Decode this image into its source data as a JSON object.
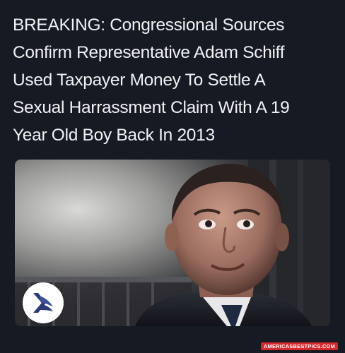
{
  "post": {
    "headline_lines": [
      "BREAKING: Congressional Sources",
      "Confirm Representative Adam Schiff",
      "Used Taxpayer Money To Settle A",
      "Sexual Harrassment Claim With A 19",
      "Year Old Boy Back In 2013"
    ]
  },
  "watermark": {
    "text": "AMERICASBESTPICS.COM"
  },
  "colors": {
    "background": "#161a23",
    "headline_text": "#f1f1f3",
    "watermark_bg": "#d4282c",
    "logo_mark": "#2b3a78"
  },
  "icons": {
    "logo": "eagle-logo-icon"
  }
}
